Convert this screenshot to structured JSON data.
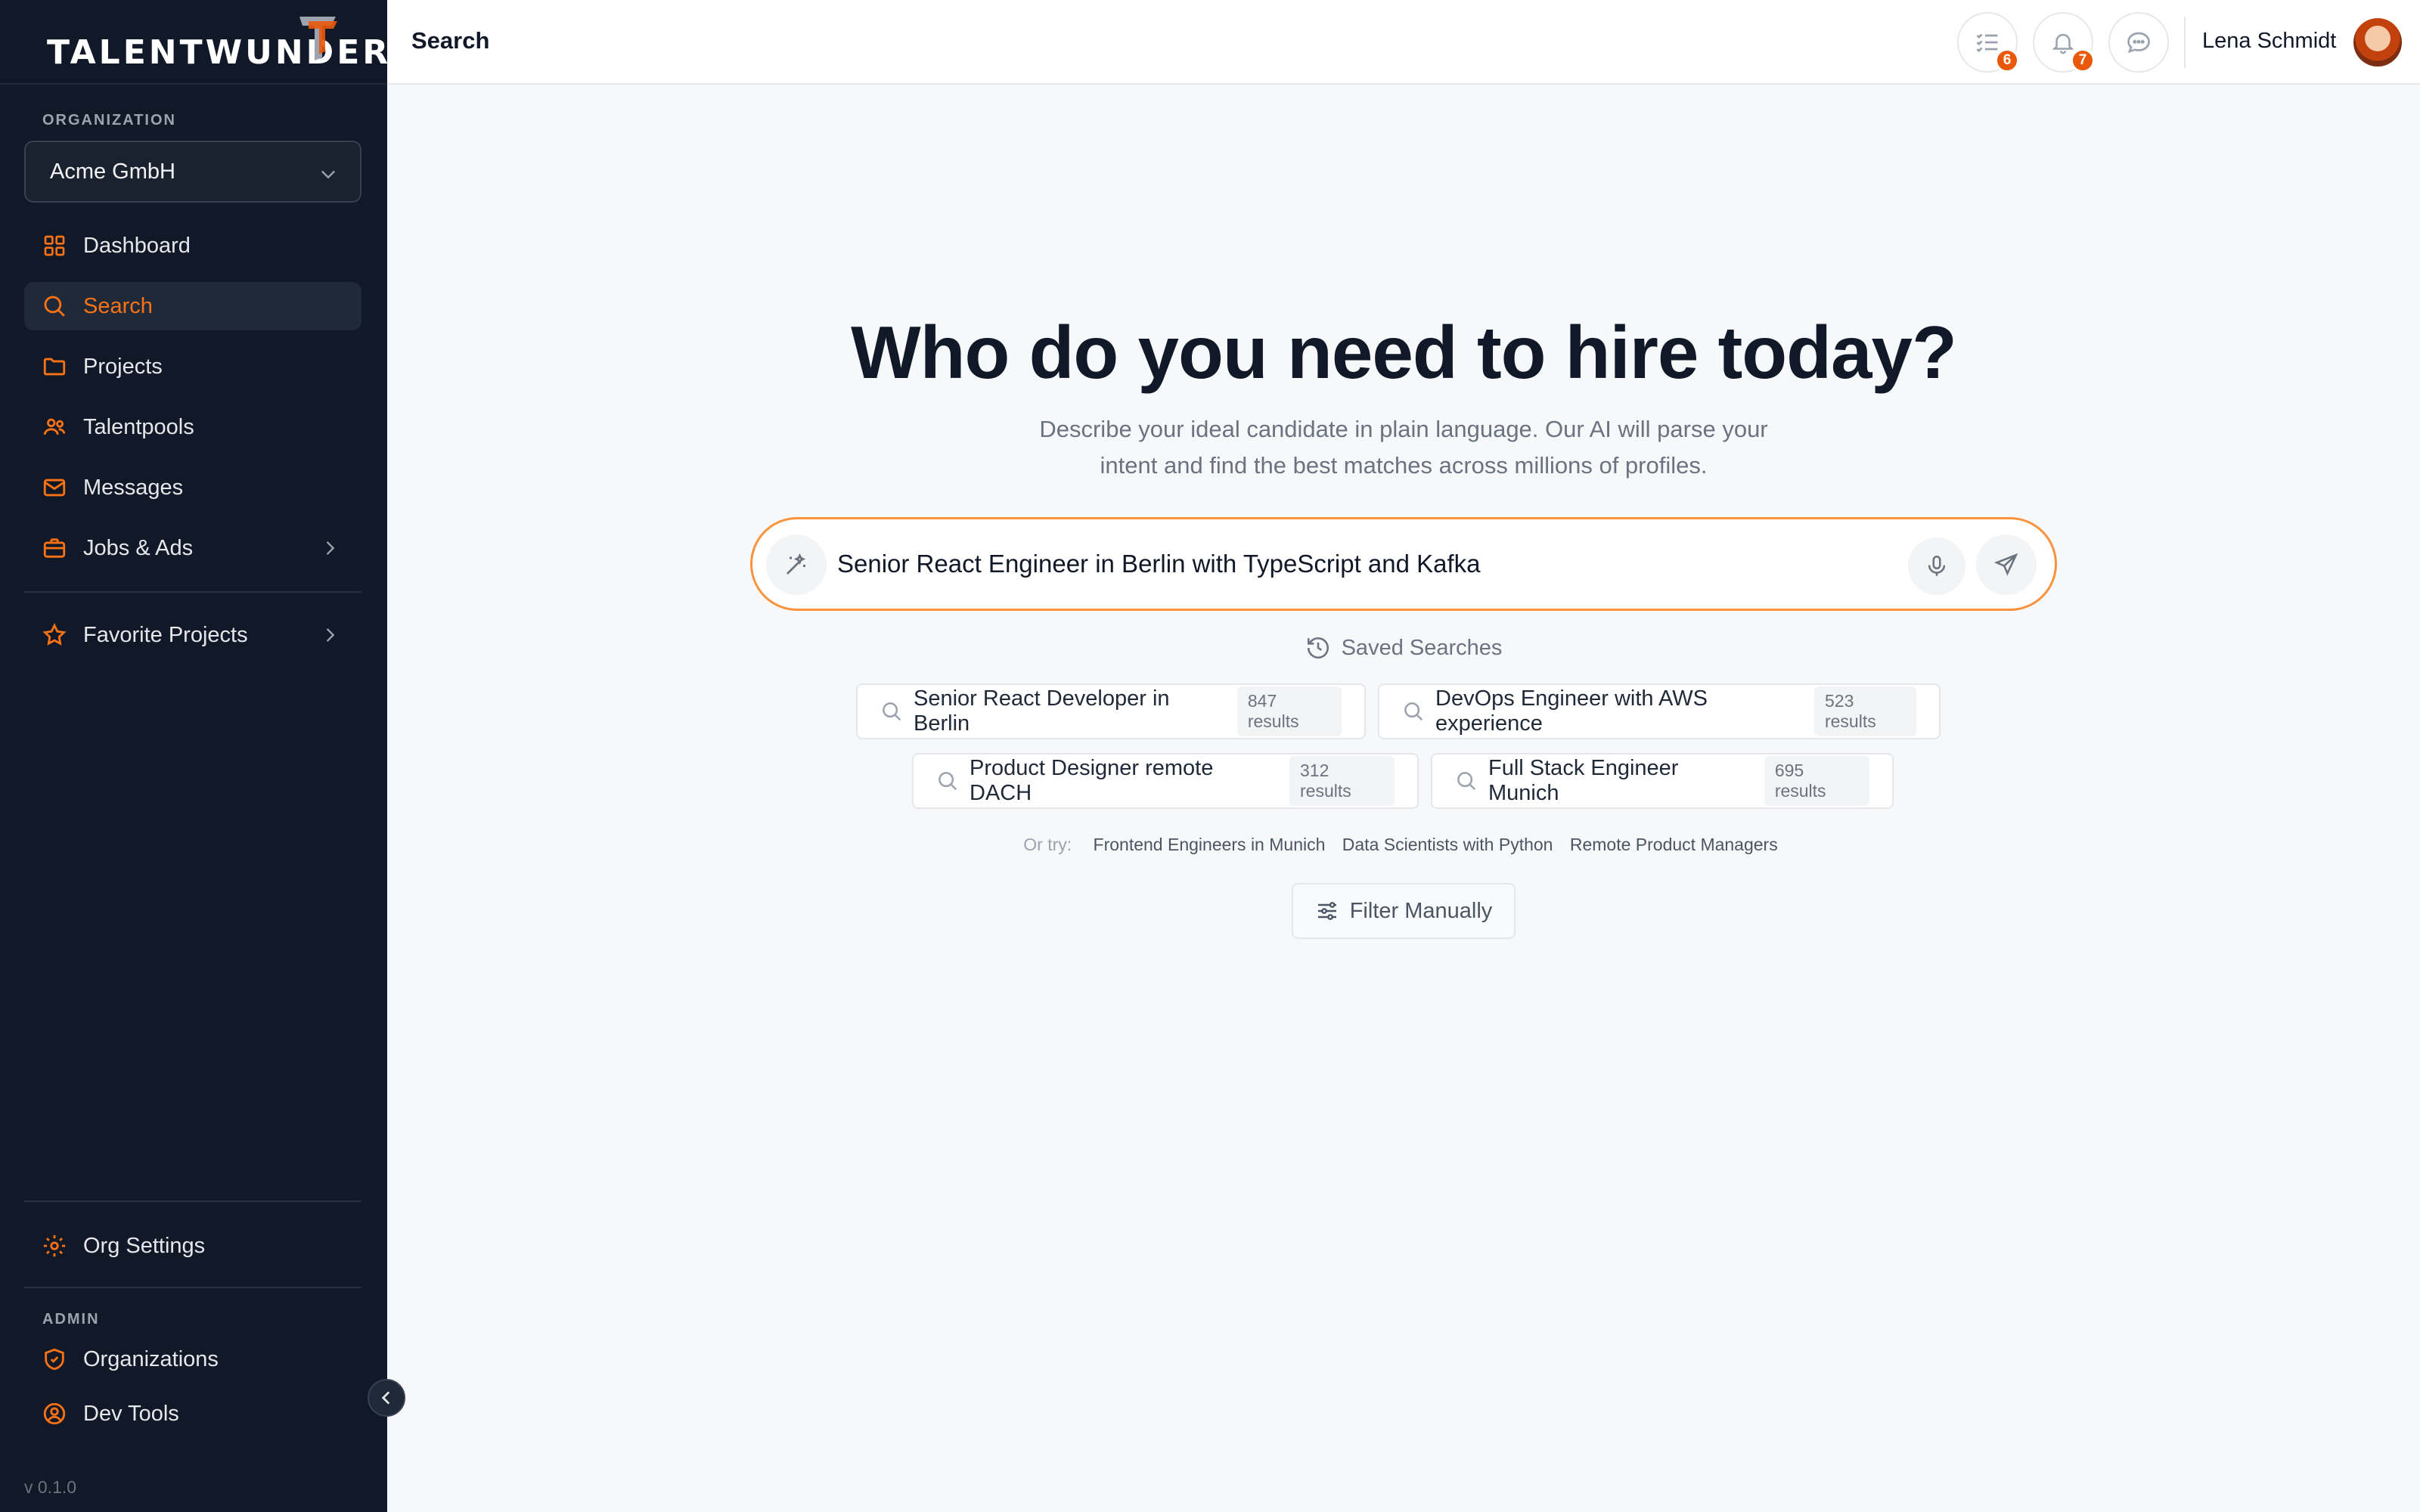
{
  "sidebar": {
    "logo_text": "TALENTWUNDER",
    "organization_label": "ORGANIZATION",
    "organization_value": "Acme GmbH",
    "nav": {
      "dashboard": "Dashboard",
      "search": "Search",
      "projects": "Projects",
      "talentpools": "Talentpools",
      "messages": "Messages",
      "jobs": "Jobs & Ads",
      "favorites": "Favorite Projects"
    },
    "org_settings": "Org Settings",
    "admin_label": "ADMIN",
    "organizations": "Organizations",
    "dev_tools": "Dev Tools",
    "version": "v 0.1.0"
  },
  "header": {
    "title": "Search",
    "tasks_count": "6",
    "notifications_count": "7",
    "user_name": "Lena Schmidt"
  },
  "main": {
    "headline": "Who do you need to hire today?",
    "subtitle": "Describe your ideal candidate in plain language. Our AI will parse your intent and find the best matches across millions of profiles.",
    "search_value": "Senior React Engineer in Berlin with TypeScript and Kafka",
    "saved_label": "Saved Searches",
    "saved": [
      {
        "label": "Senior React Developer in Berlin",
        "count": "847 results"
      },
      {
        "label": "DevOps Engineer with AWS experience",
        "count": "523 results"
      },
      {
        "label": "Product Designer remote DACH",
        "count": "312 results"
      },
      {
        "label": "Full Stack Engineer Munich",
        "count": "695 results"
      }
    ],
    "or_try_label": "Or try:",
    "suggestions": [
      "Frontend Engineers in Munich",
      "Data Scientists with Python",
      "Remote Product Managers"
    ],
    "filter_label": "Filter Manually"
  },
  "colors": {
    "accent": "#f97316",
    "sidebar_bg": "#111827",
    "badge": "#ea580c"
  }
}
